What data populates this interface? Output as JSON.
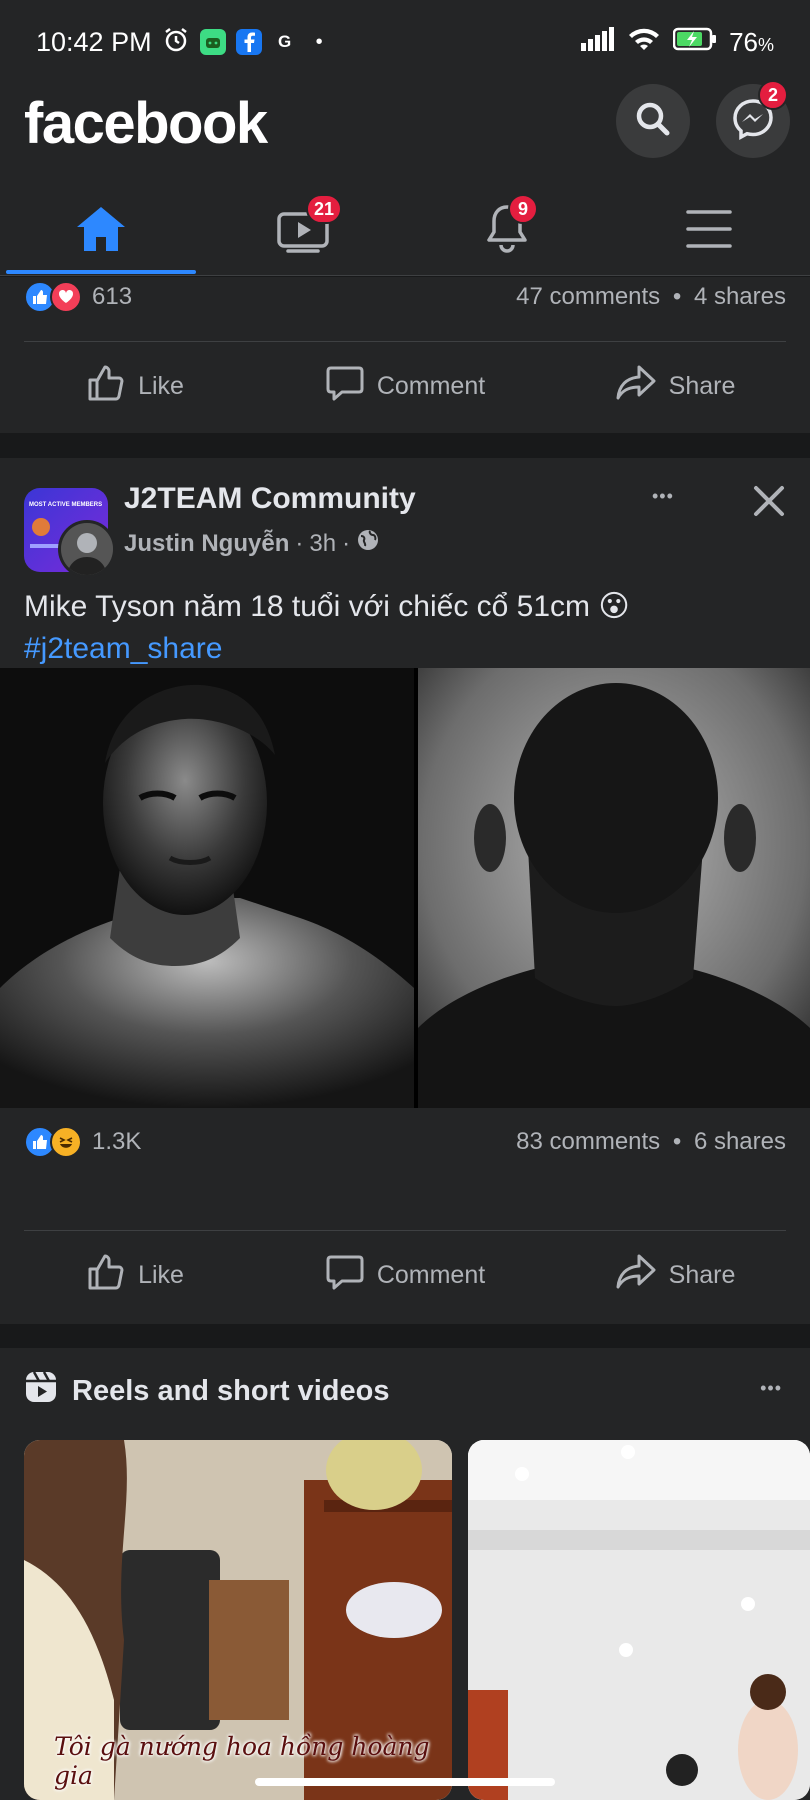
{
  "status_bar": {
    "time": "10:42 PM",
    "battery": "76",
    "battery_suffix": "%",
    "icons": [
      "alarm-icon",
      "android-icon",
      "facebook-icon",
      "google-icon",
      "dot-icon",
      "signal-icon",
      "wifi-icon",
      "battery-icon"
    ],
    "google_letter": "G",
    "dot": "•"
  },
  "header": {
    "logo": "facebook",
    "messenger_badge": "2"
  },
  "tabs": [
    {
      "name": "home",
      "icon": "home-icon",
      "active": true
    },
    {
      "name": "watch",
      "icon": "video-icon",
      "badge": "21"
    },
    {
      "name": "notifications",
      "icon": "bell-icon",
      "badge": "9"
    },
    {
      "name": "menu",
      "icon": "menu-icon"
    }
  ],
  "post1": {
    "reactions_count": "613",
    "comments": "47 comments",
    "shares": "4 shares",
    "separator": "•",
    "actions": {
      "like": "Like",
      "comment": "Comment",
      "share": "Share"
    }
  },
  "post2": {
    "group": "J2TEAM Community",
    "group_avatar_text": "MOST ACTIVE MEMBERS",
    "author": "Justin Nguyễn",
    "time": "3h",
    "separator": "·",
    "text": "Mike Tyson năm 18 tuổi với chiếc cổ 51cm",
    "emoji": "😮",
    "hashtag": "#j2team_share",
    "reactions_count": "1.3K",
    "comments": "83 comments",
    "shares": "6 shares",
    "dot": "•",
    "more": "•••",
    "actions": {
      "like": "Like",
      "comment": "Comment",
      "share": "Share"
    }
  },
  "reels": {
    "title": "Reels and short videos",
    "more": "•••",
    "items": [
      {
        "caption": "Tôi gà nướng hoa hồng hoàng gia"
      },
      {
        "caption": ""
      }
    ]
  },
  "colors": {
    "background": "#18191a",
    "surface": "#242526",
    "accent": "#2d88ff",
    "badge": "#e41e3f",
    "text": "#e4e6eb",
    "secondary": "#b0b3b8"
  }
}
